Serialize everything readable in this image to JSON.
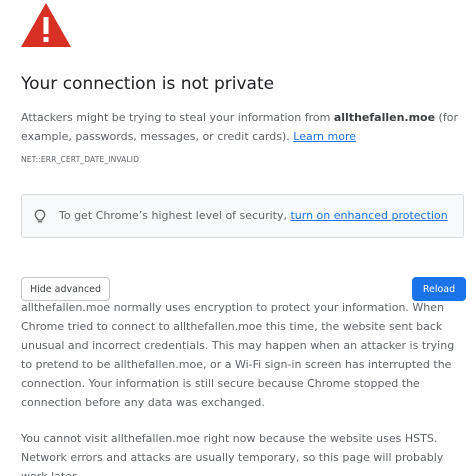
{
  "page": {
    "title": "Your connection is not private",
    "intro": {
      "before": "Attackers might be trying to steal your information from ",
      "domain": "allthefallen.moe",
      "after": " (for example, passwords, messages, or credit cards). ",
      "learn_more": "Learn more"
    },
    "error_code": "NET::ERR_CERT_DATE_INVALID",
    "protection": {
      "text": "To get Chrome’s highest level of security, ",
      "link": "turn on enhanced protection"
    },
    "buttons": {
      "hide_advanced": "Hide advanced",
      "reload": "Reload"
    },
    "details": "allthefallen.moe normally uses encryption to protect your information. When Chrome tried to connect to allthefallen.moe this time, the website sent back unusual and incorrect credentials. This may happen when an attacker is trying to pretend to be allthefallen.moe, or a Wi-Fi sign-in screen has interrupted the connection. Your information is still secure because Chrome stopped the connection before any data was exchanged.",
    "hsts": "You cannot visit allthefallen.moe right now because the website uses HSTS. Network errors and attacks are usually temporary, so this page will probably work later."
  },
  "icons": {
    "warning": "warning-triangle-icon",
    "bulb": "lightbulb-icon"
  },
  "colors": {
    "warning_red": "#d93025",
    "link_blue": "#1a73e8",
    "primary_button": "#1a73e8",
    "body_text": "#5f6368"
  }
}
